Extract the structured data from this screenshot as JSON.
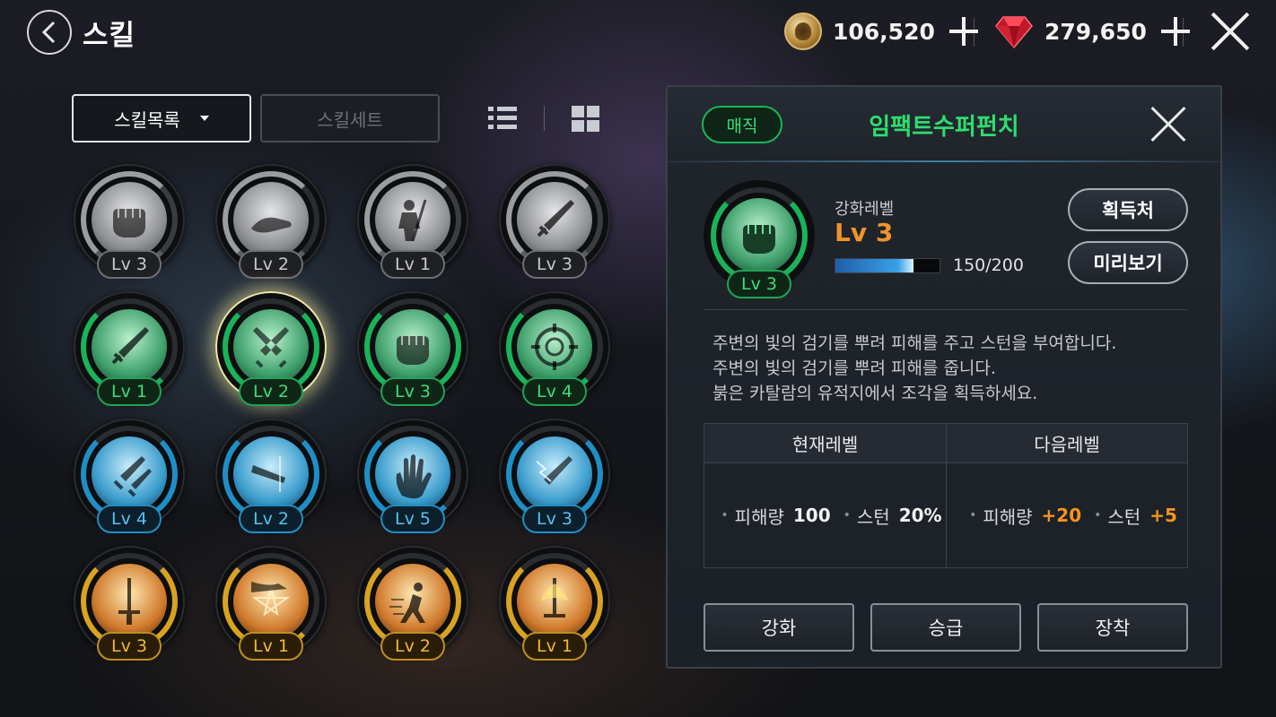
{
  "header": {
    "title": "스킬",
    "gold": "106,520",
    "gems": "279,650"
  },
  "tabs": {
    "skill_list": "스킬목록",
    "skill_set": "스킬세트"
  },
  "skills": [
    {
      "level": "Lv 3",
      "tier": "gray",
      "icon": "fist-icon"
    },
    {
      "level": "Lv 2",
      "tier": "gray",
      "icon": "kick-icon"
    },
    {
      "level": "Lv 1",
      "tier": "gray",
      "icon": "warrior-slash-icon"
    },
    {
      "level": "Lv 3",
      "tier": "gray",
      "icon": "sword-icon"
    },
    {
      "level": "Lv 1",
      "tier": "green",
      "icon": "sword-icon"
    },
    {
      "level": "Lv 2",
      "tier": "green",
      "icon": "crossed-swords-icon"
    },
    {
      "level": "Lv 3",
      "tier": "green",
      "icon": "fist-icon"
    },
    {
      "level": "Lv 4",
      "tier": "green",
      "icon": "rune-circle-icon"
    },
    {
      "level": "Lv 4",
      "tier": "blue",
      "icon": "twin-daggers-icon"
    },
    {
      "level": "Lv 2",
      "tier": "blue",
      "icon": "dagger-strike-icon"
    },
    {
      "level": "Lv 5",
      "tier": "blue",
      "icon": "open-hand-icon"
    },
    {
      "level": "Lv 3",
      "tier": "blue",
      "icon": "lightning-sword-icon"
    },
    {
      "level": "Lv 3",
      "tier": "gold",
      "icon": "holy-sword-icon"
    },
    {
      "level": "Lv 1",
      "tier": "gold",
      "icon": "pentagram-kick-icon"
    },
    {
      "level": "Lv 2",
      "tier": "gold",
      "icon": "dash-icon"
    },
    {
      "level": "Lv 1",
      "tier": "gold",
      "icon": "flame-sword-icon"
    }
  ],
  "detail": {
    "badge": "매직",
    "name": "임팩트수퍼펀치",
    "icon_level": "Lv 3",
    "enhance_label": "강화레벨",
    "enhance_level": "Lv 3",
    "exp_text": "150/200",
    "exp_progress": 0.75,
    "source_button": "획득처",
    "preview_button": "미리보기",
    "description": [
      "주변의 빛의 검기를 뿌려 피해를 주고 스턴을 부여합니다.",
      "주변의 빛의 검기를 뿌려 피해를 줍니다.",
      "붉은 카탈람의 유적지에서 조각을 획득하세요."
    ],
    "table": {
      "current_header": "현재레벨",
      "next_header": "다음레벨",
      "current": {
        "damage_label": "피해량",
        "damage_value": "100",
        "stun_label": "스턴",
        "stun_value": "20%"
      },
      "next": {
        "damage_label": "피해량",
        "damage_value": "+20",
        "stun_label": "스턴",
        "stun_value": "+5"
      }
    },
    "buttons": {
      "enhance": "강화",
      "promote": "승급",
      "equip": "장착"
    }
  },
  "colors": {
    "green": "#19b35a",
    "blue": "#1e8fc6",
    "gold": "#d9a220",
    "accent_orange": "#f0932a",
    "title_green": "#2ede6f"
  }
}
